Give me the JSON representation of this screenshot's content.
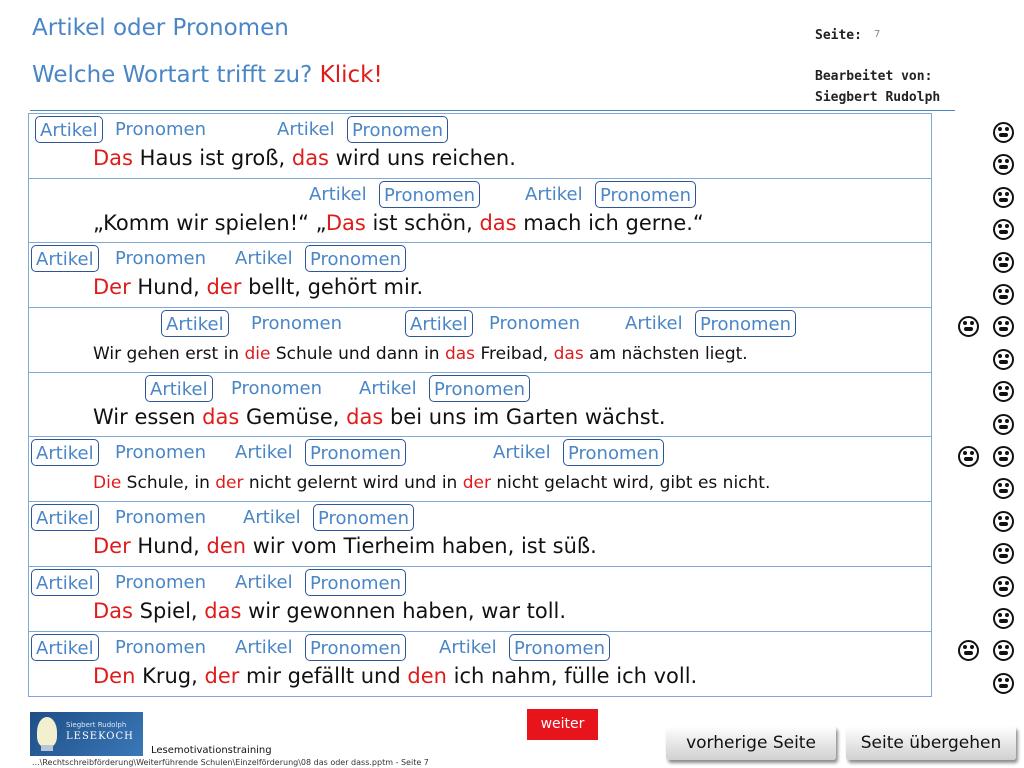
{
  "header": {
    "title": "Artikel oder Pronomen",
    "question": "Welche Wortart trifft zu?",
    "click": "Klick!",
    "page_label": "Seite:",
    "page_number": "7",
    "editor_label": "Bearbeitet  von:",
    "editor_name": "Siegbert  Rudolph"
  },
  "labels": {
    "artikel": "Artikel",
    "pronomen": "Pronomen"
  },
  "exercises": [
    {
      "parts": [
        "Das",
        " Haus ist groß, ",
        "das",
        " wird uns reichen."
      ]
    },
    {
      "parts": [
        "„Komm wir spielen!“ „",
        "Das",
        " ist schön, ",
        "das",
        " mach ich gerne.“"
      ]
    },
    {
      "parts": [
        "Der",
        " Hund, ",
        "der",
        " bellt, gehört mir."
      ]
    },
    {
      "parts": [
        "Wir gehen  erst in ",
        "die",
        " Schule und dann in ",
        "das",
        " Freibad, ",
        "das",
        " am nächsten liegt."
      ]
    },
    {
      "parts": [
        "Wir essen ",
        "das",
        " Gemüse, ",
        "das",
        " bei uns im Garten wächst."
      ]
    },
    {
      "parts": [
        "Die",
        " Schule, in ",
        "der",
        " nicht gelernt wird und in ",
        "der",
        " nicht gelacht wird, gibt es nicht."
      ]
    },
    {
      "parts": [
        "Der",
        " Hund, ",
        "den",
        " wir vom Tierheim haben, ist süß."
      ]
    },
    {
      "parts": [
        "Das",
        " Spiel, ",
        "das",
        " wir gewonnen haben, war toll."
      ]
    },
    {
      "parts": [
        "Den",
        " Krug, ",
        "der",
        " mir gefällt und ",
        "den",
        " ich nahm, fülle ich voll."
      ]
    }
  ],
  "footer": {
    "weiter": "weiter",
    "logo_small": "Siegbert Rudolph",
    "logo_main": "LESEKOCH",
    "program": "Lesemotivationstraining",
    "path": "...\\Rechtschreibförderung\\Weiterführende Schulen\\Einzelförderung\\08 das oder dass.pptm - Seite 7",
    "prev": "vorherige Seite",
    "skip": "Seite übergehen"
  },
  "colors": {
    "accent": "#4a86c6",
    "highlight": "#e01b1b",
    "box_border": "#2f5597"
  },
  "icons": {
    "face": "frown-face-icon"
  }
}
